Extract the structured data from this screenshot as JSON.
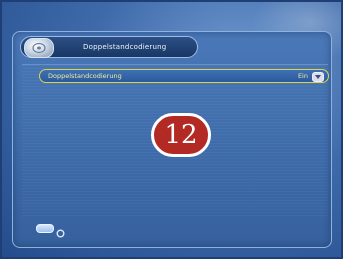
{
  "menu": {
    "title": "Doppelstandcodierung",
    "icon": "settings-disc-icon"
  },
  "setting": {
    "label": "Doppelstandcodierung",
    "value": "Ein",
    "dropdown_icon": "chevron-down-icon"
  },
  "badge": {
    "number": "12"
  },
  "footer": {
    "back_icon": "back-button-icon",
    "ok_icon": "circle-icon"
  },
  "colors": {
    "background": "#3f6aaa",
    "highlight_border": "#d9d44a",
    "highlight_text": "#f3ee9a",
    "badge": "#b32a25"
  }
}
